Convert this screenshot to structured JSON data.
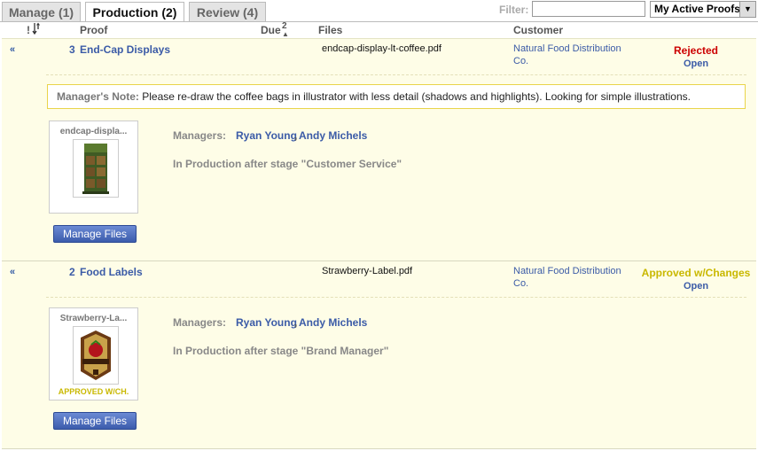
{
  "tabs": [
    {
      "label": "Manage (1)"
    },
    {
      "label": "Production (2)"
    },
    {
      "label": "Review (4)"
    }
  ],
  "filter": {
    "label": "Filter:",
    "value": "",
    "select_value": "My Active Proofs"
  },
  "header": {
    "priority": "!",
    "sort_icon": "sort-arrows-icon",
    "proof": "Proof",
    "due": "Due",
    "due_badge": "2",
    "files": "Files",
    "customer": "Customer"
  },
  "rows": [
    {
      "num": "3",
      "proof": "End-Cap Displays",
      "file": "endcap-display-lt-coffee.pdf",
      "customer_line1": "Natural Food Distribution",
      "customer_line2": "Co.",
      "status": "Rejected",
      "status_color": "#cc0000",
      "open": "Open",
      "note_label": "Manager's Note:",
      "note_text": "Please re-draw the coffee bags in illustrator with less detail (shadows and highlights). Looking for simple illustrations.",
      "thumb_name": "endcap-displa...",
      "thumb_status": "",
      "manage_files": "Manage Files",
      "managers_label": "Managers:",
      "manager1": "Ryan Young",
      "manager2": "Andy Michels",
      "stage": "In Production after stage \"Customer Service\""
    },
    {
      "num": "2",
      "proof": "Food Labels",
      "file": "Strawberry-Label.pdf",
      "customer_line1": "Natural Food Distribution",
      "customer_line2": "Co.",
      "status": "Approved w/Changes",
      "status_color": "#c9b800",
      "open": "Open",
      "thumb_name": "Strawberry-La...",
      "thumb_status": "APPROVED W/CH.",
      "manage_files": "Manage Files",
      "managers_label": "Managers:",
      "manager1": "Ryan Young",
      "manager2": "Andy Michels",
      "stage": "In Production after stage \"Brand Manager\""
    }
  ],
  "colors": {
    "accent": "#3b5ba7",
    "row_bg": "#fefde7",
    "rejected": "#cc0000",
    "approved_changes": "#c9b800"
  }
}
